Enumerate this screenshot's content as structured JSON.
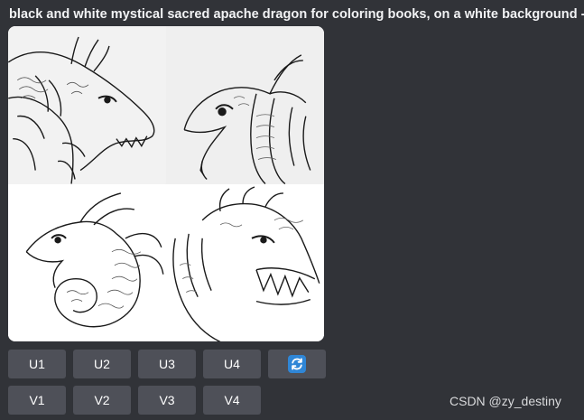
{
  "message": {
    "prompt": "black and white mystical sacred apache dragon for coloring books, on a white background -"
  },
  "image_grid": {
    "tiles": [
      {
        "icon": "dragon-image"
      },
      {
        "icon": "dragon-image"
      },
      {
        "icon": "dragon-image"
      },
      {
        "icon": "dragon-image"
      }
    ]
  },
  "upscale_buttons": [
    "U1",
    "U2",
    "U3",
    "U4"
  ],
  "variation_buttons": [
    "V1",
    "V2",
    "V3",
    "V4"
  ],
  "reroll_button": {
    "icon": "refresh-icon",
    "color": "#2f86d6"
  },
  "watermark": "CSDN @zy_destiny",
  "colors": {
    "background": "#313338",
    "button": "#4e5058",
    "text": "#f2f3f5"
  }
}
